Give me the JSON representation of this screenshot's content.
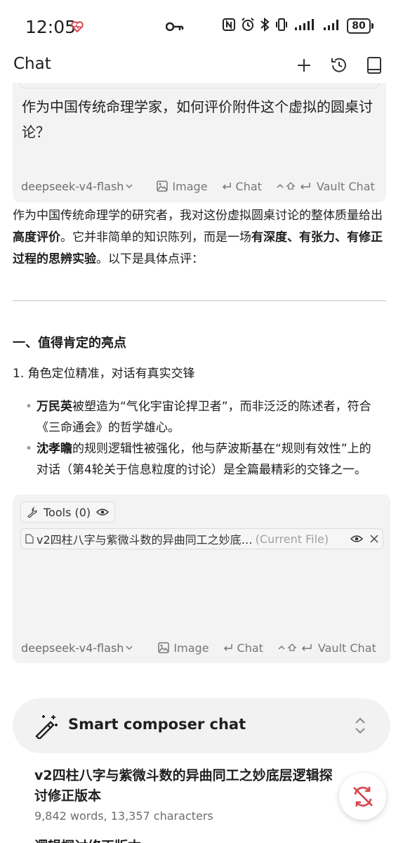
{
  "status": {
    "time": "12:05",
    "battery": "80"
  },
  "header": {
    "title": "Chat"
  },
  "message": {
    "text": "作为中国传统命理学家，如何评价附件这个虚拟的圆桌讨论？"
  },
  "toolbar": {
    "model": "deepseek-v4-flash",
    "image_label": "Image",
    "chat_label": "Chat",
    "vault_chat_label": "Vault Chat"
  },
  "answer": {
    "intro_1": "作为中国传统命理学的研究者，我对这份虚拟圆桌讨论的整体质量给出",
    "intro_bold_1": "高度评价",
    "intro_2": "。它并非简单的知识陈列，而是一场",
    "intro_bold_2": "有深度、有张力、有修正过程的思辨实验",
    "intro_3": "。以下是具体点评：",
    "section_1": "一、值得肯定的亮点",
    "subsection_1": "1. 角色定位精准，对话有真实交锋",
    "bullets": [
      {
        "bold": "万民英",
        "text": "被塑造为“气化宇宙论捍卫者”，而非泛泛的陈述者，符合《三命通会》的哲学雄心。"
      },
      {
        "bold": "沈孝瞻",
        "text": "的规则逻辑性被强化，他与萨波斯基在“规则有效性”上的对话（第4轮关于信息粒度的讨论）是全篇最精彩的交锋之一。"
      }
    ]
  },
  "composer": {
    "tools_label": "Tools (0)",
    "file_name": "v2四柱八字与紫微斗数的异曲同工之妙底…",
    "file_tag": "(Current File)"
  },
  "smart_composer": {
    "label": "Smart composer chat"
  },
  "file_panel": {
    "title": "v2四柱八字与紫微斗数的异曲同工之妙底层逻辑探讨修正版本",
    "stats": "9,842 words, 13,357 characters",
    "next_title": "逻辑探讨修正版本"
  },
  "colors": {
    "accent_red": "#d9434e",
    "box_bg": "#f3f3f3"
  }
}
